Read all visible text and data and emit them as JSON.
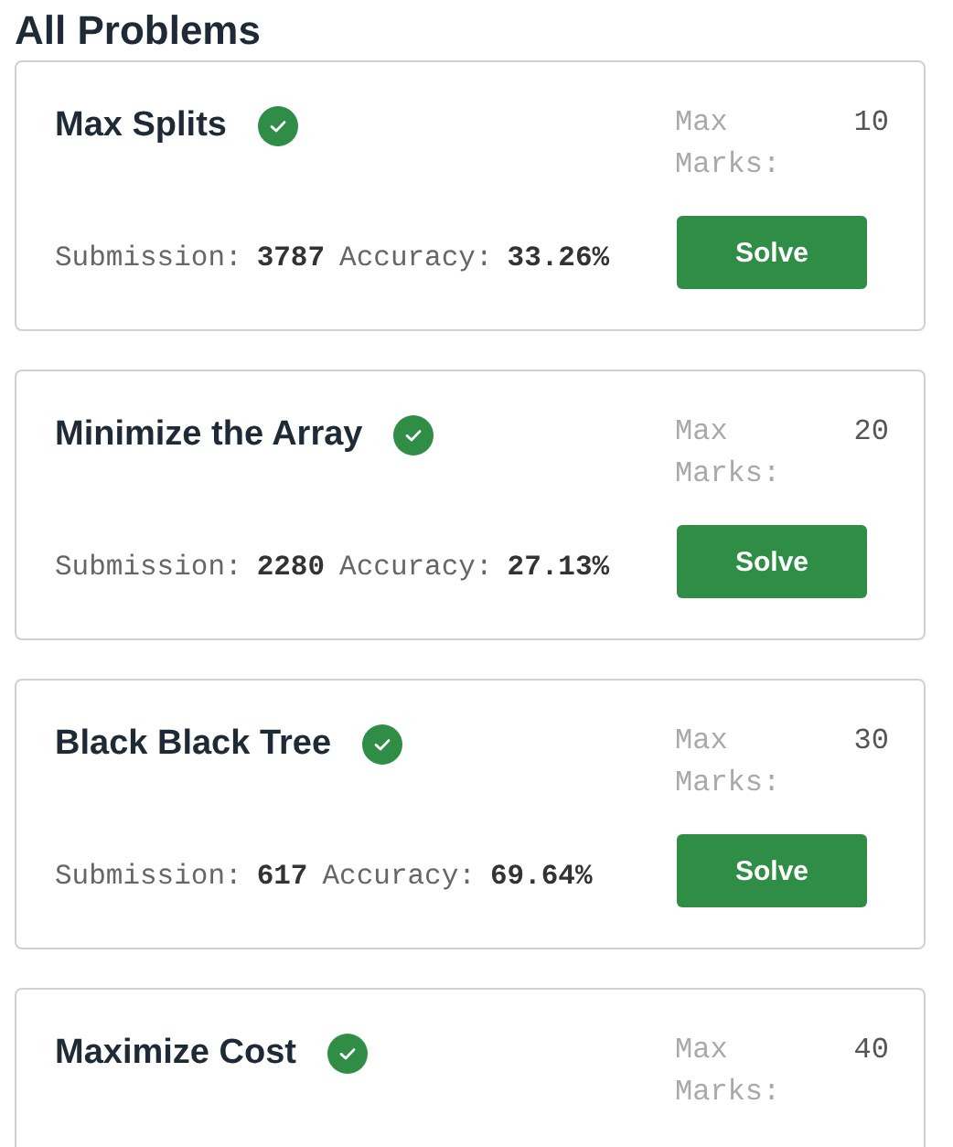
{
  "heading": "All Problems",
  "problems": [
    {
      "title": "Max Splits",
      "solved": true,
      "max_label": "Max Marks:",
      "max_marks": "10",
      "submission_label": "Submission:",
      "submissions": "3787",
      "accuracy_label": "Accuracy:",
      "accuracy": "33.26%",
      "button": "Solve"
    },
    {
      "title": "Minimize the Array",
      "solved": true,
      "max_label": "Max Marks:",
      "max_marks": "20",
      "submission_label": "Submission:",
      "submissions": "2280",
      "accuracy_label": "Accuracy:",
      "accuracy": "27.13%",
      "button": "Solve"
    },
    {
      "title": "Black Black Tree",
      "solved": true,
      "max_label": "Max Marks:",
      "max_marks": "30",
      "submission_label": "Submission:",
      "submissions": "617",
      "accuracy_label": "Accuracy:",
      "accuracy": "69.64%",
      "button": "Solve"
    },
    {
      "title": "Maximize Cost",
      "solved": true,
      "max_label": "Max Marks:",
      "max_marks": "40"
    }
  ]
}
